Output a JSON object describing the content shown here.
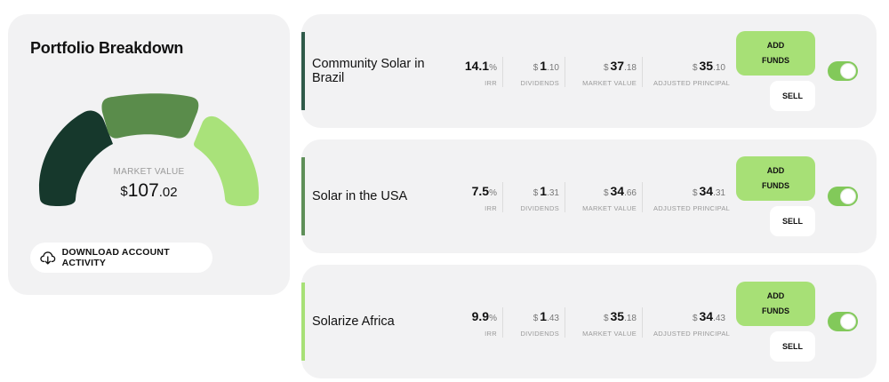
{
  "summary": {
    "title": "Portfolio Breakdown",
    "market_value_label": "MARKET VALUE",
    "market_value_currency": "$",
    "market_value_int": "107",
    "market_value_dec": ".02",
    "download_label": "DOWNLOAD ACCOUNT ACTIVITY",
    "gauge_segment_colors": [
      "#16382c",
      "#5a8c4b",
      "#a9e27a"
    ]
  },
  "labels": {
    "irr": "IRR",
    "dividends": "DIVIDENDS",
    "market_value": "MARKET VALUE",
    "adjusted_principal": "ADJUSTED PRINCIPAL",
    "add_funds": "ADD\nFUNDS",
    "sell": "SELL"
  },
  "projects": [
    {
      "name": "Community Solar in Brazil",
      "accent_color": "#2f5a49",
      "irr_int": "14.1",
      "irr_unit": "%",
      "div_cur": "$",
      "div_int": "1",
      "div_dec": ".10",
      "mv_cur": "$",
      "mv_int": "37",
      "mv_dec": ".18",
      "ap_cur": "$",
      "ap_int": "35",
      "ap_dec": ".10",
      "toggle_on": true
    },
    {
      "name": "Solar in the USA",
      "accent_color": "#5e8f58",
      "irr_int": "7.5",
      "irr_unit": "%",
      "div_cur": "$",
      "div_int": "1",
      "div_dec": ".31",
      "mv_cur": "$",
      "mv_int": "34",
      "mv_dec": ".66",
      "ap_cur": "$",
      "ap_int": "34",
      "ap_dec": ".31",
      "toggle_on": true
    },
    {
      "name": "Solarize Africa",
      "accent_color": "#a7e076",
      "irr_int": "9.9",
      "irr_unit": "%",
      "div_cur": "$",
      "div_int": "1",
      "div_dec": ".43",
      "mv_cur": "$",
      "mv_int": "35",
      "mv_dec": ".18",
      "ap_cur": "$",
      "ap_int": "34",
      "ap_dec": ".43",
      "toggle_on": true
    }
  ]
}
